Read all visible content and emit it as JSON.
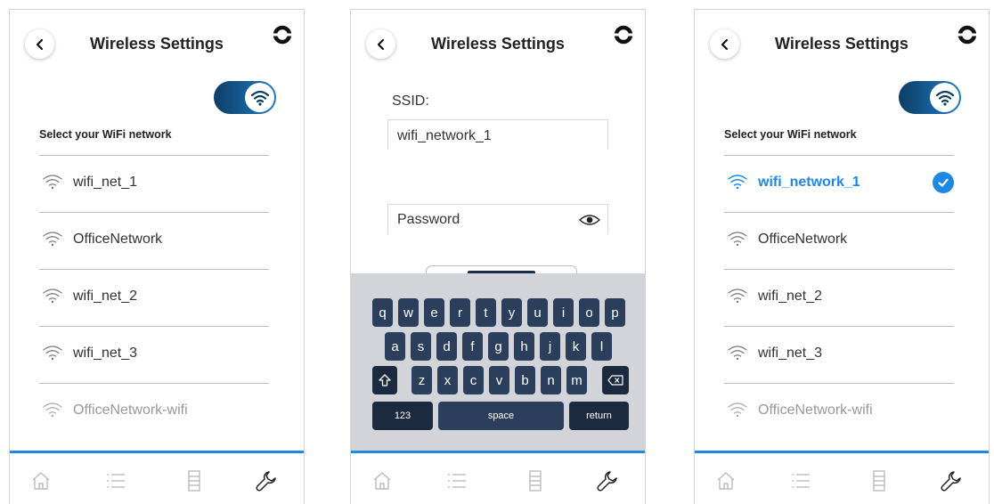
{
  "colors": {
    "accent": "#1e88e5",
    "toggle_dark": "#0d3e66",
    "key_bg": "#2b3f5c",
    "keyboard_bg": "#d3d4d9"
  },
  "panels": [
    {
      "title": "Wireless Settings",
      "select_label": "Select your WiFi network",
      "networks": [
        {
          "name": "wifi_net_1"
        },
        {
          "name": "OfficeNetwork"
        },
        {
          "name": "wifi_net_2"
        },
        {
          "name": "wifi_net_3"
        },
        {
          "name": "OfficeNetwork-wifi"
        }
      ]
    },
    {
      "title": "Wireless Settings",
      "ssid_label": "SSID:",
      "ssid_value": "wifi_network_1",
      "password_placeholder": "Password",
      "keyboard": {
        "row1": [
          "q",
          "w",
          "e",
          "r",
          "t",
          "y",
          "u",
          "i",
          "o",
          "p"
        ],
        "row2": [
          "a",
          "s",
          "d",
          "f",
          "g",
          "h",
          "j",
          "k",
          "l"
        ],
        "row3": [
          "z",
          "x",
          "c",
          "v",
          "b",
          "n",
          "m"
        ],
        "numbers_label": "123",
        "space_label": "space",
        "return_label": "return"
      }
    },
    {
      "title": "Wireless Settings",
      "select_label": "Select your WiFi network",
      "networks": [
        {
          "name": "wifi_network_1"
        },
        {
          "name": "OfficeNetwork"
        },
        {
          "name": "wifi_net_2"
        },
        {
          "name": "wifi_net_3"
        },
        {
          "name": "OfficeNetwork-wifi"
        }
      ]
    }
  ],
  "icons": {
    "back": "chevron-left-icon",
    "logo": "brand-logo-icon",
    "wifi": "wifi-icon",
    "eye": "eye-icon",
    "tabs": [
      "home-icon",
      "list-icon",
      "device-icon",
      "wrench-icon"
    ]
  }
}
